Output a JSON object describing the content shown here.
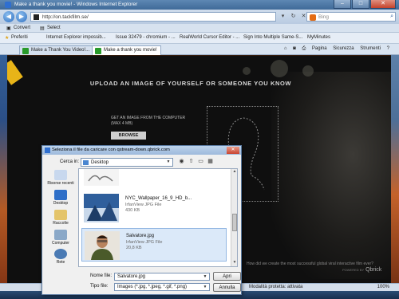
{
  "browser": {
    "window_title": "Make a thank you movie! - Windows Internet Explorer",
    "address_url": "http://on.tackfilm.se/",
    "search_placeholder": "Bing",
    "command_items": [
      "Convert",
      "Select"
    ],
    "favorites": {
      "label": "Preferiti",
      "items": [
        "Internet Explorer impossib...",
        "Issue 32479 - chromium - ...",
        "RealWorld Cursor Editor - ...",
        "Sign Into Multiple Same-S...",
        "MyMinutes"
      ]
    },
    "tabs": [
      {
        "label": "Make a Thank You Video!...",
        "active": false
      },
      {
        "label": "Make a thank you movie!",
        "active": true
      }
    ],
    "tab_tools": [
      "Pagina",
      "Sicurezza",
      "Strumenti"
    ],
    "status_text": "Modalità protetta: attivata",
    "zoom": "100%"
  },
  "page": {
    "headline": "UPLOAD AN IMAGE OF YOURSELF OR SOMEONE YOU KNOW",
    "get_image_line1": "GET AN IMAGE FROM THE COMPUTER",
    "get_image_line2": "(MAX 4 MB)",
    "browse_label": "BROWSE",
    "bottom_question": "How did we create the most successful global viral interactive film ever?",
    "brand": "Qbrick",
    "brand_prefix": "POWERED BY"
  },
  "dialog": {
    "title": "Seleziona il file da caricare con qstream-down.qbrick.com",
    "look_in_label": "Cerca in:",
    "look_in_value": "Desktop",
    "places": [
      {
        "label": "Risorse recenti",
        "icon": "recent-icon"
      },
      {
        "label": "Desktop",
        "icon": "desktop-icon"
      },
      {
        "label": "Raccolte",
        "icon": "libraries-icon"
      },
      {
        "label": "Computer",
        "icon": "computer-icon"
      },
      {
        "label": "Rete",
        "icon": "network-icon"
      }
    ],
    "files": [
      {
        "name": "",
        "type": "",
        "size": "",
        "selected": false
      },
      {
        "name": "NYC_Wallpaper_16_9_HD_b...",
        "type": "IrfanView JPG File",
        "size": "430 KB",
        "selected": false
      },
      {
        "name": "Salvatore.jpg",
        "type": "IrfanView JPG File",
        "size": "20,8 KB",
        "selected": true
      }
    ],
    "filename_label": "Nome file:",
    "filename_value": "Salvatore.jpg",
    "filetype_label": "Tipo file:",
    "filetype_value": "Images (*.jpg, *.jpeg, *.gif, *.png)",
    "open_label": "Apri",
    "cancel_label": "Annulla"
  }
}
